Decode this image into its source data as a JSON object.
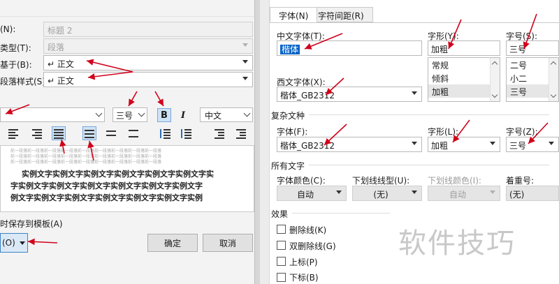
{
  "left_dialog": {
    "name_label": "(N):",
    "name_value": "标题 2",
    "type_label": "类型(T):",
    "type_value": "段落",
    "based_on_label": "基于(B):",
    "based_on_value": "↵ 正文",
    "next_style_label": "段落样式(S):",
    "next_style_value": "↵ 正文",
    "font_size_value": "三号",
    "bold_label": "B",
    "italic_label": "I",
    "lang_value": "中文",
    "preview": {
      "grey_line": "前一段落前一段落前一段落前一段落前一段落前一段落前一段落前一段落前一段落",
      "dark_line_1": "实例文字实例文字实例文字实例文字实例文字实例文字实",
      "dark_line_2": "字实例文字实例文字实例文字实例文字实例文字实例文字",
      "dark_line_3": "例文字实例文字实例文字实例文字实例文字实例文字实例"
    },
    "save_template_label": "时保存到模板(A)",
    "format_button_label": "(O)",
    "ok_label": "确定",
    "cancel_label": "取消"
  },
  "right_dialog": {
    "tabs": [
      {
        "label": "字体(N)",
        "active": true
      },
      {
        "label": "字符间距(R)",
        "active": false
      }
    ],
    "chinese_font_label": "中文字体(T):",
    "chinese_font_value": "楷体",
    "style_label": "字形(Y):",
    "style_value": "加粗",
    "style_options": [
      "常规",
      "倾斜",
      "加粗"
    ],
    "size_label": "字号(S):",
    "size_value": "三号",
    "size_options": [
      "二号",
      "小二",
      "三号"
    ],
    "western_font_label": "西文字体(X):",
    "western_font_value": "楷体_GB2312",
    "complex_section": "复杂文种",
    "complex_font_label": "字体(F):",
    "complex_font_value": "楷体_GB2312",
    "complex_style_label": "字形(L):",
    "complex_style_value": "加粗",
    "complex_size_label": "字号(Z):",
    "complex_size_value": "三号",
    "all_text_section": "所有文字",
    "font_color_label": "字体颜色(C):",
    "font_color_value": "自动",
    "underline_label": "下划线线型(U):",
    "underline_value": "(无)",
    "underline_color_label": "下划线颜色(I):",
    "underline_color_value": "自动",
    "emphasis_label": "着重号:",
    "emphasis_value": "(无)",
    "effects_section": "效果",
    "effects": [
      "删除线(K)",
      "双删除线(G)",
      "上标(P)",
      "下标(B)"
    ]
  },
  "watermark": "软件技巧",
  "colors": {
    "arrow": "#d0021b",
    "selection": "#0a64c6",
    "active_toggle": "#cfe3f7"
  }
}
